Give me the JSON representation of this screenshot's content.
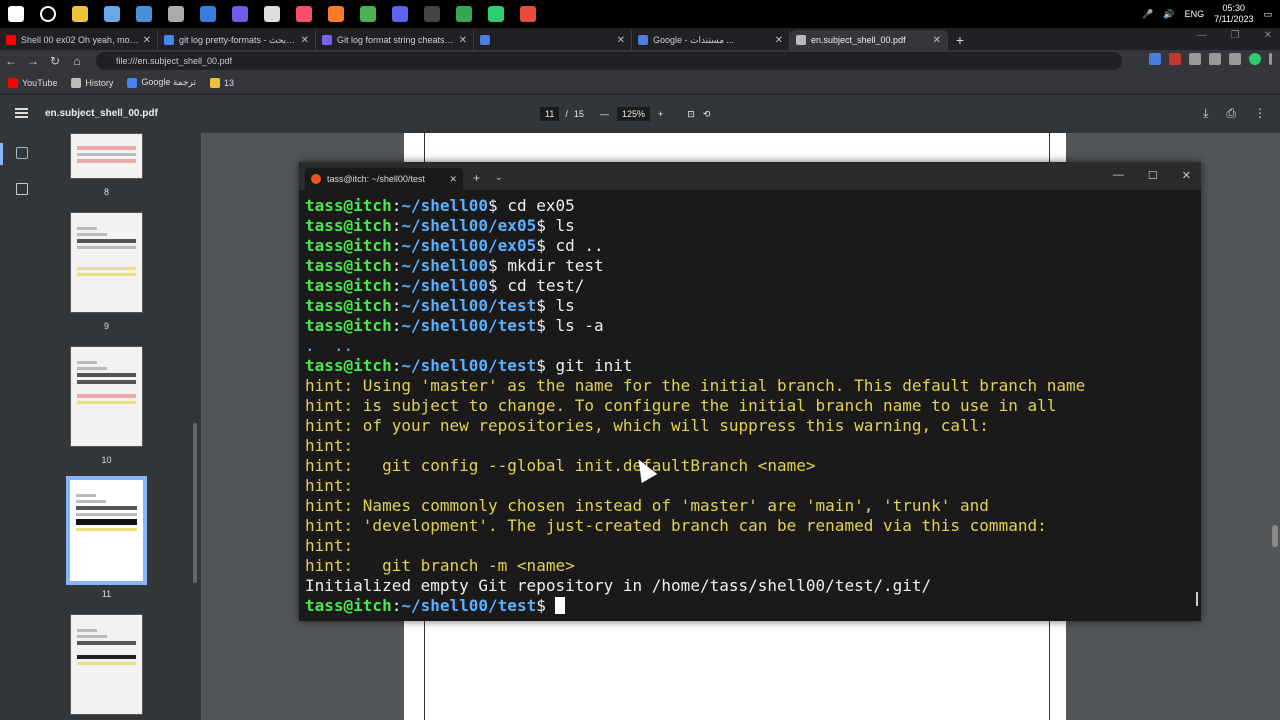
{
  "taskbar": {
    "apps": [
      "start",
      "search",
      "file-explorer",
      "notes",
      "mail",
      "chrome-pinned",
      "settings",
      "paint",
      "media",
      "app-red",
      "firefox",
      "chrome",
      "discord",
      "terminal",
      "chrome-alt",
      "green-app",
      "red-app"
    ],
    "lang": "ENG",
    "time": "05:30",
    "date": "7/11/2023"
  },
  "tabs": [
    {
      "title": "Shell 00 ex02 Oh yeah, mooore...",
      "color": "#ff0000"
    },
    {
      "title": "git log pretty-formats - بحث Goo...",
      "color": "#4285f4"
    },
    {
      "title": "Git log format string cheatsheet",
      "color": "#7b61ff"
    },
    {
      "title": "",
      "color": "#4a7dde"
    },
    {
      "title": "Google - مستندات ...",
      "color": "#4a7dde"
    },
    {
      "title": "en.subject_shell_00.pdf",
      "color": "#bbbbbb",
      "active": true
    }
  ],
  "address": {
    "url": "file:///en.subject_shell_00.pdf"
  },
  "bookmarks": [
    {
      "label": "YouTube",
      "color": "#ff0000"
    },
    {
      "label": "History",
      "color": "#bbbbbb"
    },
    {
      "label": "Google ترجمة",
      "color": "#4285f4"
    },
    {
      "label": "13",
      "color": "#f0c43a"
    }
  ],
  "pdf": {
    "title": "en.subject_shell_00.pdf",
    "page_current": "11",
    "page_sep": "/",
    "page_total": "15",
    "zoom": "125%",
    "thumb_labels": [
      "8",
      "9",
      "10",
      "11"
    ]
  },
  "terminal": {
    "tab_title": "tass@itch: ~/shell00/test",
    "lines": [
      {
        "user": "tass@itch",
        "path": "~/shell00",
        "cmd": " cd ex05"
      },
      {
        "user": "tass@itch",
        "path": "~/shell00/ex05",
        "cmd": " ls"
      },
      {
        "user": "tass@itch",
        "path": "~/shell00/ex05",
        "cmd": " cd .."
      },
      {
        "user": "tass@itch",
        "path": "~/shell00",
        "cmd": " mkdir test"
      },
      {
        "user": "tass@itch",
        "path": "~/shell00",
        "cmd": " cd test/"
      },
      {
        "user": "tass@itch",
        "path": "~/shell00/test",
        "cmd": " ls"
      },
      {
        "user": "tass@itch",
        "path": "~/shell00/test",
        "cmd": " ls -a"
      },
      {
        "out": ".  ..",
        "kind": "dots"
      },
      {
        "user": "tass@itch",
        "path": "~/shell00/test",
        "cmd": " git init"
      },
      {
        "out": "hint: Using 'master' as the name for the initial branch. This default branch name",
        "kind": "hint"
      },
      {
        "out": "hint: is subject to change. To configure the initial branch name to use in all",
        "kind": "hint"
      },
      {
        "out": "hint: of your new repositories, which will suppress this warning, call:",
        "kind": "hint"
      },
      {
        "out": "hint:",
        "kind": "hint"
      },
      {
        "out": "hint:   git config --global init.defaultBranch <name>",
        "kind": "hint"
      },
      {
        "out": "hint:",
        "kind": "hint"
      },
      {
        "out": "hint: Names commonly chosen instead of 'master' are 'main', 'trunk' and",
        "kind": "hint"
      },
      {
        "out": "hint: 'development'. The just-created branch can be renamed via this command:",
        "kind": "hint"
      },
      {
        "out": "hint:",
        "kind": "hint"
      },
      {
        "out": "hint:   git branch -m <name>",
        "kind": "hint"
      },
      {
        "out": "Initialized empty Git repository in /home/tass/shell00/test/.git/",
        "kind": "plain"
      },
      {
        "user": "tass@itch",
        "path": "~/shell00/test",
        "cmd": " ",
        "cursor": true
      }
    ]
  }
}
